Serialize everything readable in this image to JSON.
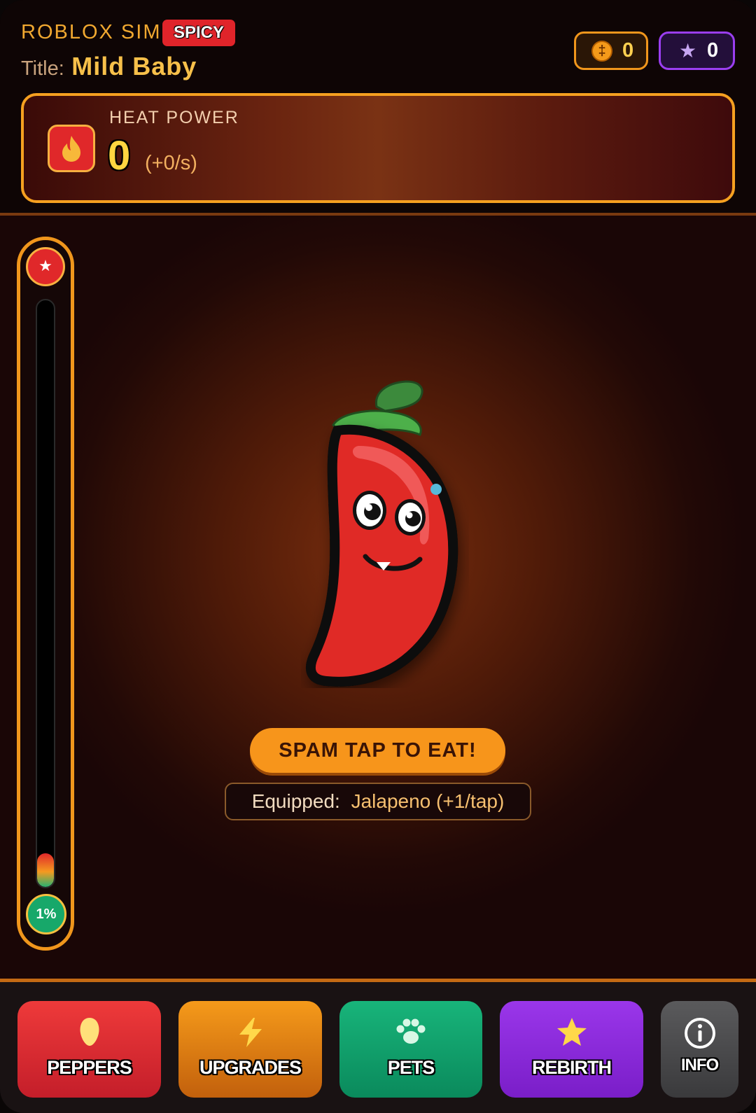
{
  "header": {
    "app_name": "ROBLOX SIM",
    "badge": "SPICY",
    "title_label": "Title:",
    "title_value": "Mild Baby",
    "coins": "0",
    "stars": "0"
  },
  "heat": {
    "label": "HEAT POWER",
    "value": "0",
    "rate": "(+0/s)"
  },
  "meter": {
    "percent_label": "1%",
    "fill_fraction": 0.01
  },
  "stage": {
    "tap_button": "SPAM TAP TO EAT!",
    "equipped_label": "Equipped:",
    "equipped_value": "Jalapeno (+1/tap)"
  },
  "nav": {
    "peppers": "PEPPERS",
    "upgrades": "UPGRADES",
    "pets": "PETS",
    "rebirth": "REBIRTH",
    "info": "INFO"
  },
  "icons": [
    "coin-icon",
    "star-icon",
    "flame-icon",
    "pepper-icon",
    "bolt-icon",
    "paw-icon",
    "info-icon"
  ],
  "colors": {
    "accent_orange": "#f5a020",
    "spicy_red": "#e0242a",
    "title_gold": "#f7c04a",
    "rebirth_purple": "#9a36ea",
    "pets_green": "#18b47a"
  }
}
